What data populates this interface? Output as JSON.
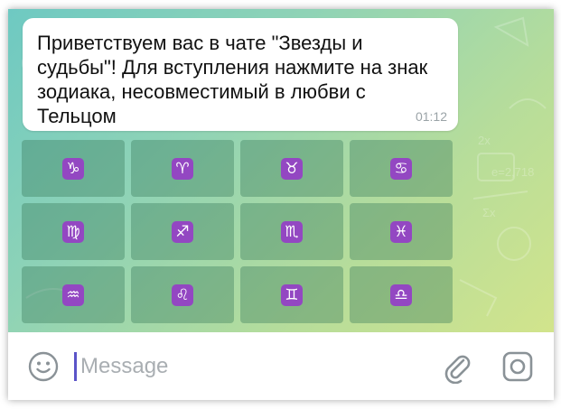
{
  "message": {
    "text": "Приветствуем вас в чате \"Звезды и судьбы\"! Для вступления нажмите на знак зодиака, несовместимый в любви с Тельцом",
    "time": "01:12"
  },
  "keyboard": {
    "buttons": [
      {
        "symbol": "♑",
        "icon": "capricorn-icon"
      },
      {
        "symbol": "♈",
        "icon": "aries-icon"
      },
      {
        "symbol": "♉",
        "icon": "taurus-icon"
      },
      {
        "symbol": "♋",
        "icon": "cancer-icon"
      },
      {
        "symbol": "♍",
        "icon": "virgo-icon"
      },
      {
        "symbol": "♐",
        "icon": "sagittarius-icon"
      },
      {
        "symbol": "♏",
        "icon": "scorpio-icon"
      },
      {
        "symbol": "♓",
        "icon": "pisces-icon"
      },
      {
        "symbol": "♒",
        "icon": "aquarius-icon"
      },
      {
        "symbol": "♌",
        "icon": "leo-icon"
      },
      {
        "symbol": "♊",
        "icon": "gemini-icon"
      },
      {
        "symbol": "♎",
        "icon": "libra-icon"
      }
    ]
  },
  "input": {
    "placeholder": "Message",
    "value": ""
  },
  "icons": {
    "emoji": "smile-icon",
    "attach": "paperclip-icon",
    "camera": "camera-icon"
  },
  "colors": {
    "sign_icon_bg": "#9347c2",
    "cursor": "#5b54c8"
  }
}
